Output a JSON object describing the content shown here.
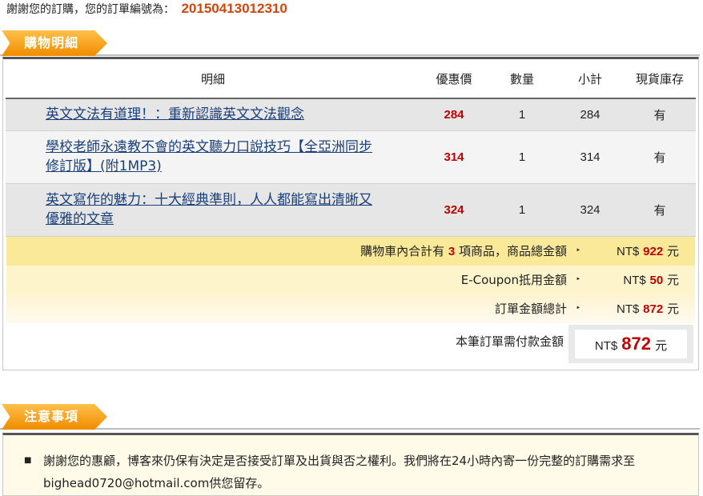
{
  "header": {
    "thanks_text": "謝謝您的訂購，您的訂單編號為：",
    "order_number": "20150413012310"
  },
  "cart_section": {
    "title": "購物明細",
    "columns": [
      "明細",
      "優惠價",
      "數量",
      "小計",
      "現貨庫存"
    ],
    "items": [
      {
        "title_line1": "英文文法有道理！：重新認識英文文法觀念",
        "title_line2": "",
        "price": "284",
        "qty": "1",
        "subtotal": "284",
        "stock": "有"
      },
      {
        "title_line1": "學校老師永遠教不會的英文聽力口說技巧【全亞洲同步",
        "title_line2": "修訂版】(附1MP3)",
        "price": "314",
        "qty": "1",
        "subtotal": "314",
        "stock": "有"
      },
      {
        "title_line1": "英文寫作的魅力：十大經典準則，人人都能寫出清晰又",
        "title_line2": "優雅的文章",
        "price": "324",
        "qty": "1",
        "subtotal": "324",
        "stock": "有"
      }
    ],
    "summary": {
      "count_prefix": "購物車內合計有",
      "count": "3",
      "count_suffix": "項商品，商品總金額",
      "total_currency": "NT$",
      "total": "922",
      "unit": "元",
      "coupon_label": "E-Coupon抵用金額",
      "coupon_currency": "NT$",
      "coupon": "50",
      "order_total_label": "訂單金額總計",
      "order_total_currency": "NT$",
      "order_total": "872",
      "arrow": "‣"
    },
    "payment": {
      "label": "本筆訂單需付款金額",
      "currency": "NT$",
      "amount": "872",
      "unit": "元"
    }
  },
  "notice_section": {
    "title": "注意事項",
    "bullet": "■",
    "items": [
      "謝謝您的惠顧，博客來仍保有決定是否接受訂單及出貨與否之權利。我們將在24小時內寄一份完整的訂購需求至bighead0720@hotmail.com供您留存。"
    ]
  },
  "colors": {
    "accent_orange": "#f08c00",
    "price_red": "#c00000",
    "order_number": "#d4450b",
    "link_blue": "#1a3f7a"
  }
}
